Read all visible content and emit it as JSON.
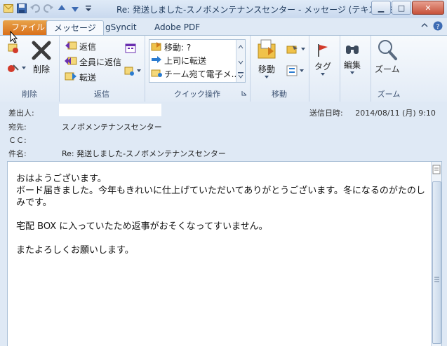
{
  "window": {
    "title": "Re: 発送しました-スノボメンテナンスセンター  -  メッセージ (テキスト形式)",
    "controls": {
      "minimize": "▁",
      "maximize": "□",
      "close": "✕"
    }
  },
  "tabs": [
    {
      "label": "ファイル"
    },
    {
      "label": "メッセージ"
    },
    {
      "label": "gSyncit"
    },
    {
      "label": "Adobe PDF"
    }
  ],
  "ribbon": {
    "delete_group": {
      "label": "削除",
      "delete_button": "削除"
    },
    "reply_group": {
      "label": "返信",
      "reply": "返信",
      "reply_all": "全員に返信",
      "forward": "転送"
    },
    "quick_group": {
      "label": "クイック操作",
      "items": [
        "移動: ?",
        "上司に転送",
        "チーム宛て電子メ..."
      ]
    },
    "move_group": {
      "label": "移動",
      "move_button": "移動"
    },
    "tags_group": {
      "tag_button": "タグ"
    },
    "edit_group": {
      "edit_button": "編集"
    },
    "zoom_group": {
      "label": "ズーム",
      "zoom_button": "ズーム"
    }
  },
  "header": {
    "sender_label": "差出人:",
    "sent_label": "送信日時:",
    "sent_value": "2014/08/11 (月) 9:10",
    "to_label": "宛先:",
    "to_value": "スノボメンテナンスセンター",
    "cc_label": "ＣＣ:",
    "subject_label": "件名:",
    "subject_value": "Re: 発送しました-スノボメンテナンスセンター"
  },
  "body": {
    "lines": [
      "おはようございます。",
      "ボード届きました。今年もきれいに仕上げていただいてありがとうございます。冬になるのがたのしみです。",
      "",
      "宅配 BOX に入っていたため返事がおそくなってすいません。",
      "",
      "またよろしくお願いします。"
    ]
  },
  "colors": {
    "accent_file_tab": "#d9701a",
    "ribbon_text": "#3d5373"
  }
}
